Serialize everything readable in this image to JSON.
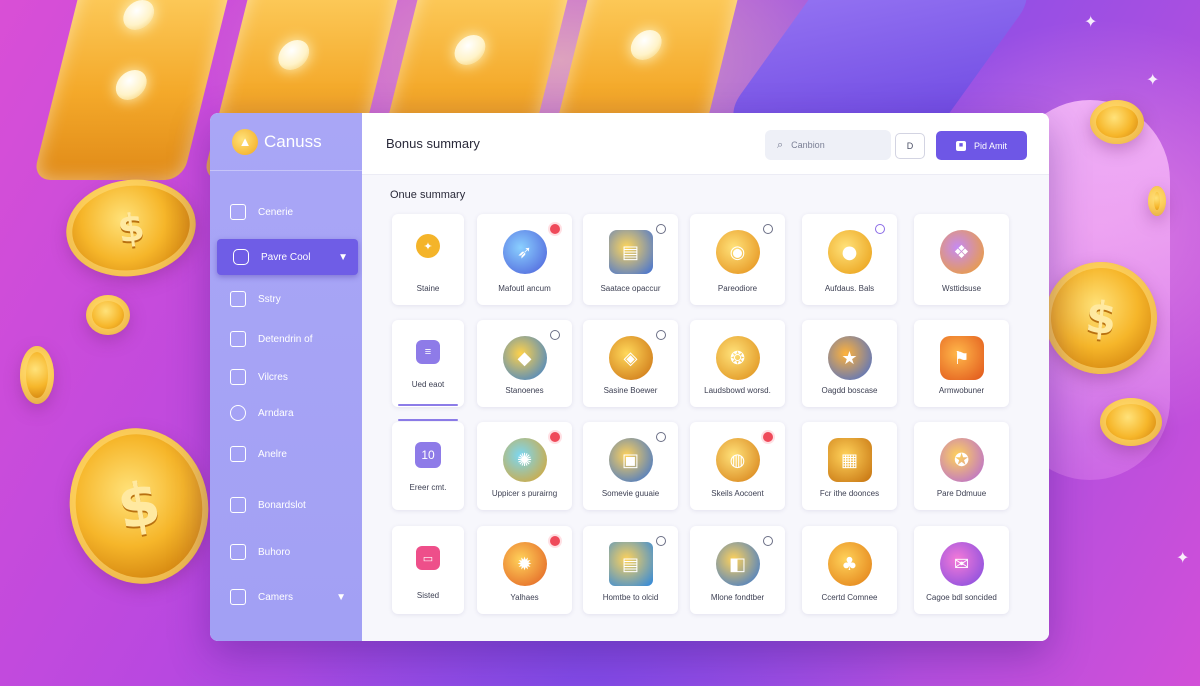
{
  "brand": {
    "name": "Canuss",
    "logo_icon": "coin-logo-icon"
  },
  "sidebar": {
    "items": [
      {
        "label": "Cenerie",
        "icon": "folder-icon"
      },
      {
        "label": "Pavre Cool",
        "icon": "wallet-icon",
        "active": true,
        "chevron": "chevron-down-icon"
      },
      {
        "label": "Sstry",
        "icon": "document-icon"
      },
      {
        "label": "Detendrin of",
        "icon": "card-icon"
      },
      {
        "label": "Vilcres",
        "icon": "gift-icon"
      },
      {
        "label": "Arndara",
        "icon": "clock-icon"
      },
      {
        "label": "Anelre",
        "icon": "list-icon"
      },
      {
        "label": "Bonardslot",
        "icon": "bookmark-icon"
      },
      {
        "label": "Buhoro",
        "icon": "square-icon"
      },
      {
        "label": "Camers",
        "icon": "calendar-icon",
        "chevron": "chevron-down-icon"
      }
    ]
  },
  "topbar": {
    "title": "Bonus summary",
    "search_placeholder": "Canbion",
    "icon_button": "D",
    "primary_label": "Pid Amit"
  },
  "section_title": "Onue summary",
  "cards": [
    [
      {
        "label": "Staine",
        "icon": "coin-swirl-icon",
        "small": true
      },
      {
        "label": "Mafoutl ancum",
        "icon": "rocket-icon",
        "badge": "red"
      },
      {
        "label": "Saatace opaccur",
        "icon": "coin-stack-icon",
        "badge": "ring"
      },
      {
        "label": "Pareodiore",
        "icon": "gold-coin-icon",
        "badge": "ring"
      },
      {
        "label": "Aufdaus. Bals",
        "icon": "gold-ball-icon",
        "badge": "ring-purple"
      },
      {
        "label": "Wsttidsuse",
        "icon": "dragon-icon"
      }
    ],
    [
      {
        "label": "Ued eaot",
        "icon": "note-icon",
        "small": true,
        "underline": true
      },
      {
        "label": "Stanoenes",
        "icon": "treasure-icon",
        "badge": "ring"
      },
      {
        "label": "Sasine Boewer",
        "icon": "gem-icon",
        "badge": "ring"
      },
      {
        "label": "Laudsbowd worsd.",
        "icon": "coin-pile-icon"
      },
      {
        "label": "Oagdd boscase",
        "icon": "star-coin-icon"
      },
      {
        "label": "Armwobuner",
        "icon": "bonus-sign-icon"
      }
    ],
    [
      {
        "label": "Ereer cmt.",
        "icon": "number-icon",
        "small": true,
        "number": "10"
      },
      {
        "label": "Uppicer s purairng",
        "icon": "shell-icon",
        "badge": "red"
      },
      {
        "label": "Somevie guuaie",
        "icon": "card-gold-icon",
        "badge": "ring"
      },
      {
        "label": "Skeils Aocoent",
        "icon": "pot-icon",
        "badge": "red"
      },
      {
        "label": "Fcr ithe doonces",
        "icon": "chest-icon"
      },
      {
        "label": "Pare Ddmuue",
        "icon": "wheel-icon"
      }
    ],
    [
      {
        "label": "Sisted",
        "icon": "tag-icon",
        "small": true
      },
      {
        "label": "Yalhaes",
        "icon": "fire-icon",
        "badge": "red"
      },
      {
        "label": "Homtbe to olcid",
        "icon": "screen-icon",
        "badge": "ring"
      },
      {
        "label": "Mlone fondtber",
        "icon": "vault-icon",
        "badge": "ring"
      },
      {
        "label": "Ccertd Comnee",
        "icon": "bag-icon"
      },
      {
        "label": "Cagoe bdl soncided",
        "icon": "cash-icon"
      }
    ]
  ],
  "colors": {
    "accent": "#6e57e6",
    "sidebar": "#a9a6f6",
    "badge_red": "#ef4a5a"
  }
}
